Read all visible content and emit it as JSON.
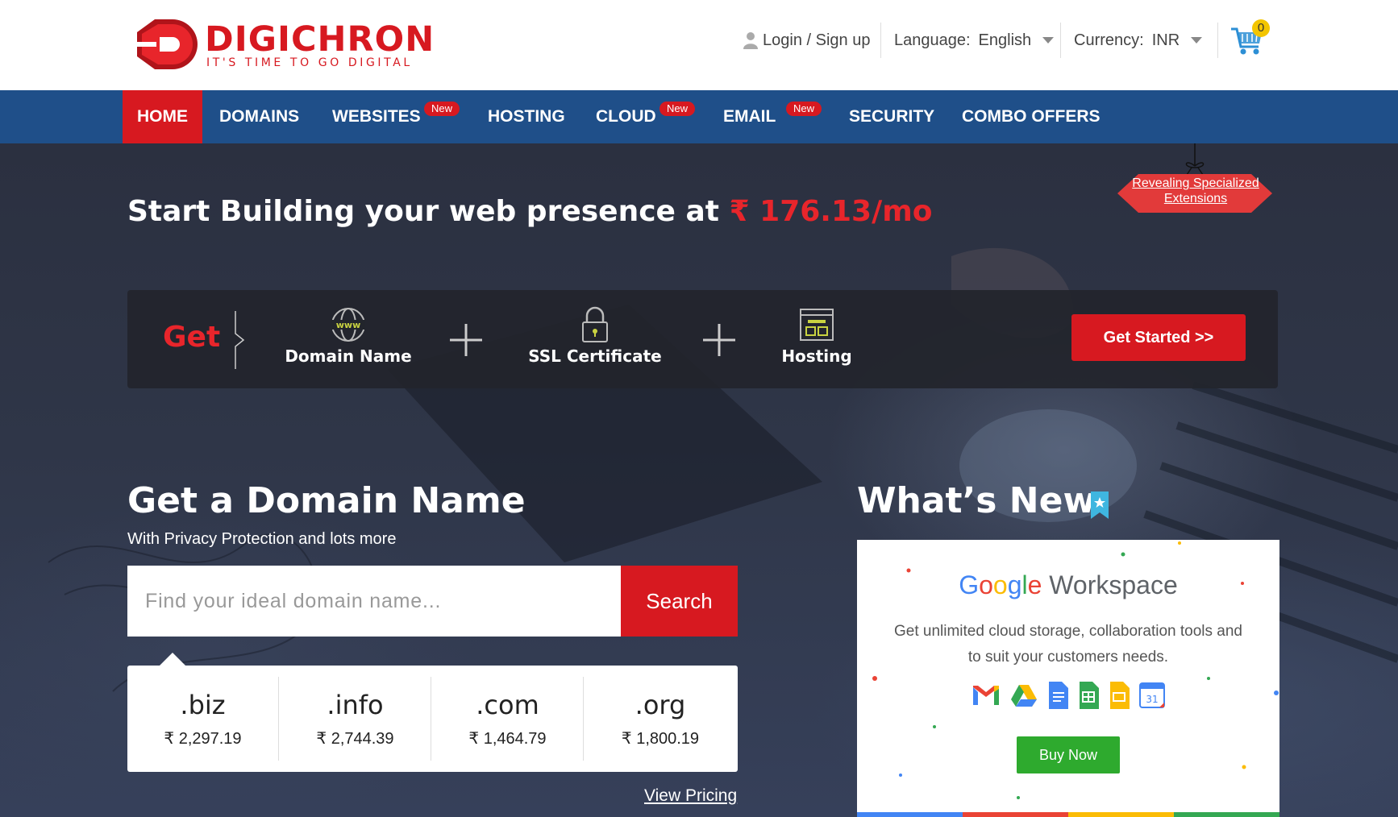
{
  "brand": {
    "name": "DIGICHRON",
    "tagline": "IT'S TIME TO GO DIGITAL",
    "color": "#d71920"
  },
  "topbar": {
    "login_label": "Login / Sign up",
    "language_label": "Language:",
    "language_value": "English",
    "currency_label": "Currency:",
    "currency_value": "INR",
    "cart_count": "0"
  },
  "nav": {
    "items": [
      {
        "label": "HOME",
        "active": true
      },
      {
        "label": "DOMAINS"
      },
      {
        "label": "WEBSITES",
        "badge": "New"
      },
      {
        "label": "HOSTING"
      },
      {
        "label": "CLOUD",
        "badge": "New"
      },
      {
        "label": "EMAIL",
        "badge": "New"
      },
      {
        "label": "SECURITY"
      },
      {
        "label": "COMBO OFFERS"
      }
    ],
    "color": "#1f4f89"
  },
  "hero": {
    "headline": "Start Building your web presence at",
    "price": "₹ 176.13/mo",
    "extensions_link": "Revealing Specialized Extensions"
  },
  "bundle": {
    "get_label": "Get",
    "items": [
      {
        "label": "Domain Name",
        "icon": "www-globe-icon"
      },
      {
        "label": "SSL Certificate",
        "icon": "padlock-icon"
      },
      {
        "label": "Hosting",
        "icon": "hosting-window-icon"
      }
    ],
    "cta": "Get Started >>"
  },
  "domain_search": {
    "title": "Get a Domain Name",
    "subtitle": "With Privacy Protection and lots more",
    "placeholder": "Find your ideal domain name...",
    "button": "Search",
    "tlds": [
      {
        "name": ".biz",
        "price": "₹ 2,297.19"
      },
      {
        "name": ".info",
        "price": "₹ 2,744.39"
      },
      {
        "name": ".com",
        "price": "₹ 1,464.79"
      },
      {
        "name": ".org",
        "price": "₹ 1,800.19"
      }
    ],
    "view_pricing": "View Pricing"
  },
  "whats_new": {
    "title": "What’s New",
    "card": {
      "brand_google": "Google",
      "brand_product": "Workspace",
      "description": "Get unlimited cloud storage, collaboration tools and to suit your customers needs.",
      "apps": [
        "gmail-icon",
        "drive-icon",
        "docs-icon",
        "sheets-icon",
        "slides-icon",
        "calendar-icon"
      ],
      "button": "Buy Now"
    }
  },
  "colors": {
    "accent_red": "#d71920",
    "nav_blue": "#1f4f89",
    "buy_green": "#2eaa2e"
  }
}
